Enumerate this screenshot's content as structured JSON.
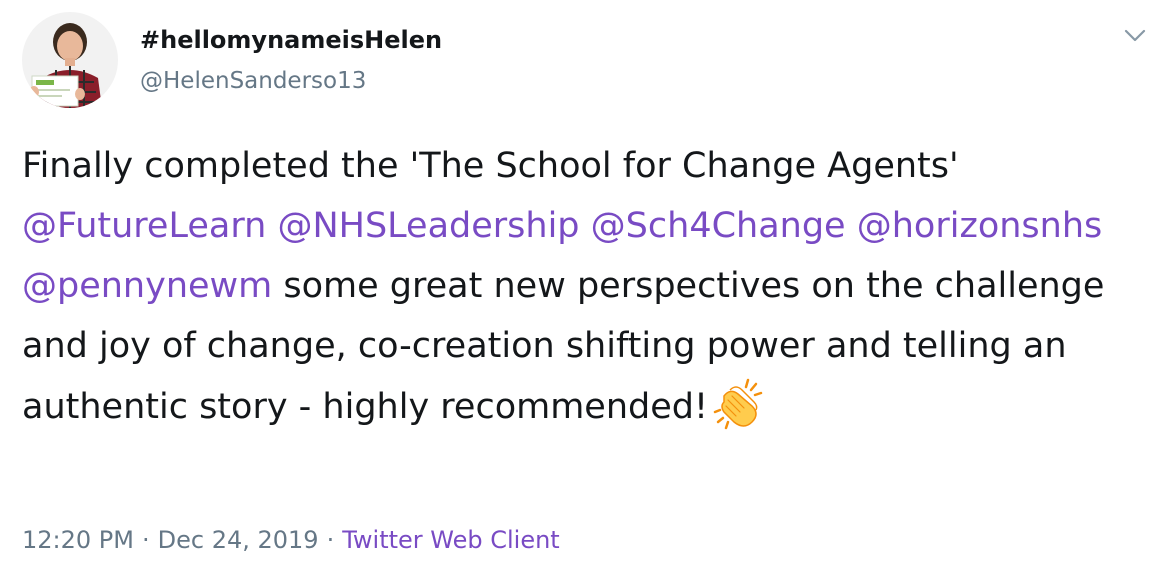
{
  "user": {
    "display_name": "#hellomynameisHelen",
    "handle": "@HelenSanderso13",
    "avatar_icon": "profile-photo-avatar"
  },
  "tweet": {
    "text_part_1": "Finally completed the 'The School for Change Agents'",
    "mentions": [
      "@FutureLearn",
      "@NHSLeadership",
      "@Sch4Change",
      "@horizonsnhs",
      "@pennynewm"
    ],
    "text_part_2": "some great new perspectives on the challenge and joy of change, co-creation shifting power and telling an authentic story - highly recommended!",
    "emoji_icon": "clapping-hands-icon"
  },
  "meta": {
    "time": "12:20 PM",
    "separator": "·",
    "date": "Dec 24, 2019",
    "client": "Twitter Web Client"
  },
  "colors": {
    "link": "#794bc4",
    "secondary_text": "#657786",
    "primary_text": "#14171a"
  },
  "menu": {
    "icon": "chevron-down-icon"
  }
}
